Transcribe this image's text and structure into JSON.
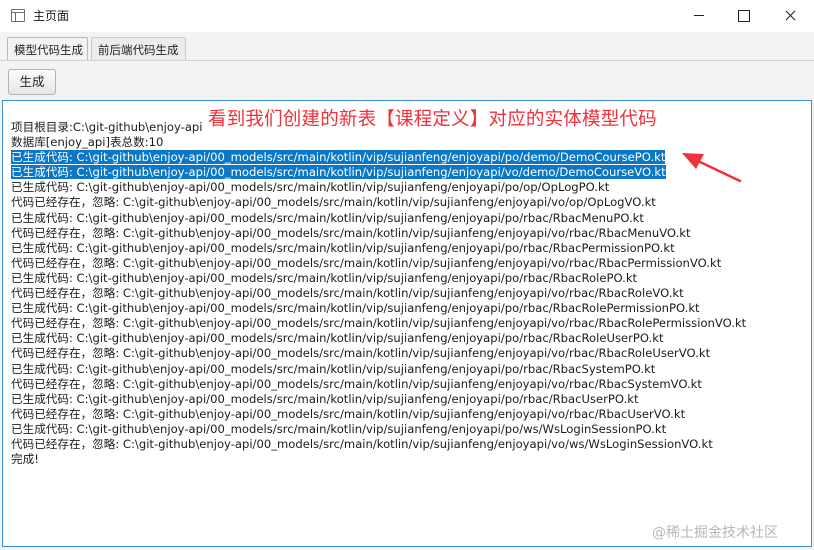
{
  "window": {
    "title": "主页面"
  },
  "tabs": [
    {
      "label": "模型代码生成",
      "active": true
    },
    {
      "label": "前后端代码生成",
      "active": false
    }
  ],
  "toolbar": {
    "generate_label": "生成"
  },
  "annotation": {
    "text": "看到我们创建的新表【课程定义】对应的实体模型代码",
    "color": "#f0303a"
  },
  "log": {
    "lines": [
      {
        "text": "项目根目录:C:\\git-github\\enjoy-api",
        "selected": false
      },
      {
        "text": "数据库[enjoy_api]表总数:10",
        "selected": false
      },
      {
        "text": "已生成代码: C:\\git-github\\enjoy-api/00_models/src/main/kotlin/vip/sujianfeng/enjoyapi/po/demo/DemoCoursePO.kt",
        "selected": true
      },
      {
        "text": "已生成代码: C:\\git-github\\enjoy-api/00_models/src/main/kotlin/vip/sujianfeng/enjoyapi/vo/demo/DemoCourseVO.kt",
        "selected": true
      },
      {
        "text": "已生成代码: C:\\git-github\\enjoy-api/00_models/src/main/kotlin/vip/sujianfeng/enjoyapi/po/op/OpLogPO.kt",
        "selected": false
      },
      {
        "text": "代码已经存在，忽略: C:\\git-github\\enjoy-api/00_models/src/main/kotlin/vip/sujianfeng/enjoyapi/vo/op/OpLogVO.kt",
        "selected": false
      },
      {
        "text": "已生成代码: C:\\git-github\\enjoy-api/00_models/src/main/kotlin/vip/sujianfeng/enjoyapi/po/rbac/RbacMenuPO.kt",
        "selected": false
      },
      {
        "text": "代码已经存在，忽略: C:\\git-github\\enjoy-api/00_models/src/main/kotlin/vip/sujianfeng/enjoyapi/vo/rbac/RbacMenuVO.kt",
        "selected": false
      },
      {
        "text": "已生成代码: C:\\git-github\\enjoy-api/00_models/src/main/kotlin/vip/sujianfeng/enjoyapi/po/rbac/RbacPermissionPO.kt",
        "selected": false
      },
      {
        "text": "代码已经存在，忽略: C:\\git-github\\enjoy-api/00_models/src/main/kotlin/vip/sujianfeng/enjoyapi/vo/rbac/RbacPermissionVO.kt",
        "selected": false
      },
      {
        "text": "已生成代码: C:\\git-github\\enjoy-api/00_models/src/main/kotlin/vip/sujianfeng/enjoyapi/po/rbac/RbacRolePO.kt",
        "selected": false
      },
      {
        "text": "代码已经存在，忽略: C:\\git-github\\enjoy-api/00_models/src/main/kotlin/vip/sujianfeng/enjoyapi/vo/rbac/RbacRoleVO.kt",
        "selected": false
      },
      {
        "text": "已生成代码: C:\\git-github\\enjoy-api/00_models/src/main/kotlin/vip/sujianfeng/enjoyapi/po/rbac/RbacRolePermissionPO.kt",
        "selected": false
      },
      {
        "text": "代码已经存在，忽略: C:\\git-github\\enjoy-api/00_models/src/main/kotlin/vip/sujianfeng/enjoyapi/vo/rbac/RbacRolePermissionVO.kt",
        "selected": false
      },
      {
        "text": "已生成代码: C:\\git-github\\enjoy-api/00_models/src/main/kotlin/vip/sujianfeng/enjoyapi/po/rbac/RbacRoleUserPO.kt",
        "selected": false
      },
      {
        "text": "代码已经存在，忽略: C:\\git-github\\enjoy-api/00_models/src/main/kotlin/vip/sujianfeng/enjoyapi/vo/rbac/RbacRoleUserVO.kt",
        "selected": false
      },
      {
        "text": "已生成代码: C:\\git-github\\enjoy-api/00_models/src/main/kotlin/vip/sujianfeng/enjoyapi/po/rbac/RbacSystemPO.kt",
        "selected": false
      },
      {
        "text": "代码已经存在，忽略: C:\\git-github\\enjoy-api/00_models/src/main/kotlin/vip/sujianfeng/enjoyapi/vo/rbac/RbacSystemVO.kt",
        "selected": false
      },
      {
        "text": "已生成代码: C:\\git-github\\enjoy-api/00_models/src/main/kotlin/vip/sujianfeng/enjoyapi/po/rbac/RbacUserPO.kt",
        "selected": false
      },
      {
        "text": "代码已经存在，忽略: C:\\git-github\\enjoy-api/00_models/src/main/kotlin/vip/sujianfeng/enjoyapi/vo/rbac/RbacUserVO.kt",
        "selected": false
      },
      {
        "text": "已生成代码: C:\\git-github\\enjoy-api/00_models/src/main/kotlin/vip/sujianfeng/enjoyapi/po/ws/WsLoginSessionPO.kt",
        "selected": false
      },
      {
        "text": "代码已经存在，忽略: C:\\git-github\\enjoy-api/00_models/src/main/kotlin/vip/sujianfeng/enjoyapi/vo/ws/WsLoginSessionVO.kt",
        "selected": false
      },
      {
        "text": "完成!",
        "selected": false
      }
    ],
    "selection_color": "#0a78c6"
  },
  "watermark": {
    "text": "@稀土掘金技术社区"
  },
  "icons": {
    "app": "window-app-icon",
    "minimize": "minimize-icon",
    "maximize": "maximize-icon",
    "close": "close-icon",
    "annotation_arrow": "red-arrow-icon"
  }
}
